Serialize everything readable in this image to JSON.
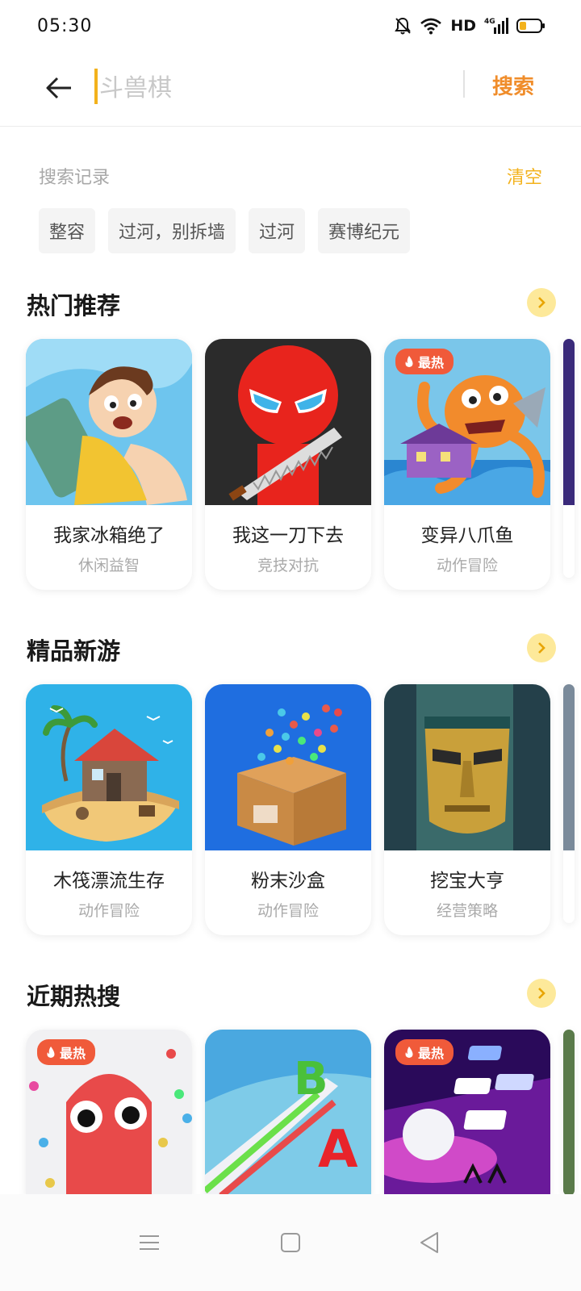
{
  "status_bar": {
    "time": "05:30",
    "network": "HD",
    "signal": "4G"
  },
  "search": {
    "placeholder": "斗兽棋",
    "button_label": "搜索"
  },
  "history": {
    "title": "搜索记录",
    "clear_label": "清空",
    "items": [
      "整容",
      "过河，别拆墙",
      "过河",
      "赛博纪元"
    ]
  },
  "sections": [
    {
      "title": "热门推荐",
      "games": [
        {
          "name": "我家冰箱绝了",
          "category": "休闲益智",
          "badge": ""
        },
        {
          "name": "我这一刀下去",
          "category": "竞技对抗",
          "badge": ""
        },
        {
          "name": "变异八爪鱼",
          "category": "动作冒险",
          "badge": "最热"
        }
      ]
    },
    {
      "title": "精品新游",
      "games": [
        {
          "name": "木筏漂流生存",
          "category": "动作冒险",
          "badge": ""
        },
        {
          "name": "粉末沙盒",
          "category": "动作冒险",
          "badge": ""
        },
        {
          "name": "挖宝大亨",
          "category": "经营策略",
          "badge": ""
        }
      ]
    },
    {
      "title": "近期热搜",
      "games": [
        {
          "badge": "最热"
        },
        {
          "badge": ""
        },
        {
          "badge": "最热"
        }
      ]
    }
  ],
  "colors": {
    "accent_orange": "#f08d2b",
    "accent_yellow": "#f3b21c",
    "badge_red": "#f05a3a",
    "more_button": "#fde99a"
  },
  "icons": {
    "back": "arrow-left-icon",
    "more": "chevron-right-icon",
    "hot": "fire-icon",
    "nav_menu": "menu-icon",
    "nav_home": "square-icon",
    "nav_back": "triangle-back-icon"
  }
}
